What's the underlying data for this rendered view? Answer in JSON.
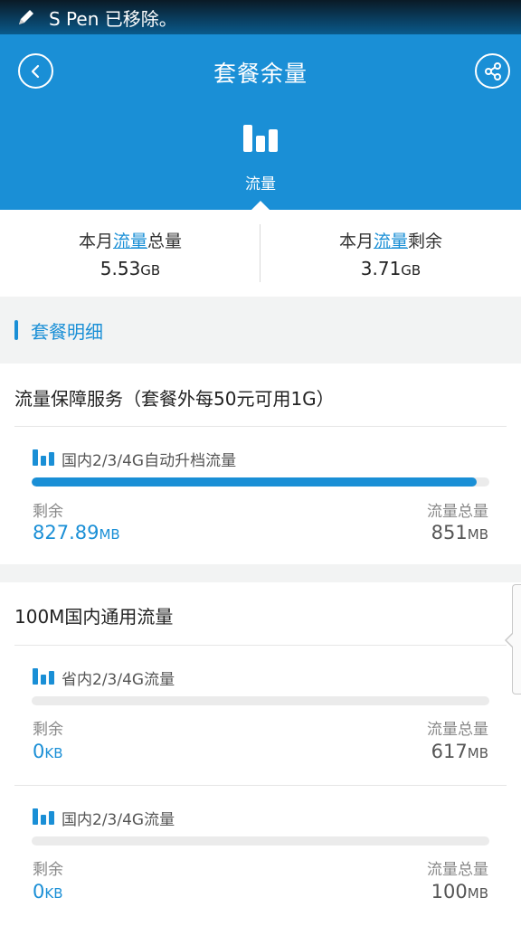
{
  "status_bar": {
    "text": "S Pen 已移除。",
    "icon": "pen-icon"
  },
  "header": {
    "title": "套餐余量",
    "back_icon": "back-icon",
    "share_icon": "share-icon",
    "tab": {
      "label": "流量",
      "icon": "bar-chart-icon"
    }
  },
  "summary": {
    "left": {
      "prefix": "本月",
      "highlight": "流量",
      "suffix": "总量",
      "value": "5.53",
      "unit": "GB"
    },
    "right": {
      "prefix": "本月",
      "highlight": "流量",
      "suffix": "剩余",
      "value": "3.71",
      "unit": "GB"
    }
  },
  "detail": {
    "title": "套餐明细"
  },
  "cards": [
    {
      "title": "流量保障服务（套餐外每50元可用1G）",
      "items": [
        {
          "name": "国内2/3/4G自动升档流量",
          "remaining_label": "剩余",
          "total_label": "流量总量",
          "remaining_value": "827.89",
          "remaining_unit": "MB",
          "total_value": "851",
          "total_unit": "MB",
          "progress": 0.973
        }
      ]
    },
    {
      "title": "100M国内通用流量",
      "items": [
        {
          "name": "省内2/3/4G流量",
          "remaining_label": "剩余",
          "total_label": "流量总量",
          "remaining_value": "0",
          "remaining_unit": "KB",
          "total_value": "617",
          "total_unit": "MB",
          "progress": 0
        },
        {
          "name": "国内2/3/4G流量",
          "remaining_label": "剩余",
          "total_label": "流量总量",
          "remaining_value": "0",
          "remaining_unit": "KB",
          "total_value": "100",
          "total_unit": "MB",
          "progress": 0
        }
      ]
    }
  ],
  "colors": {
    "primary": "#1a8fd6",
    "background": "#f2f3f3"
  }
}
